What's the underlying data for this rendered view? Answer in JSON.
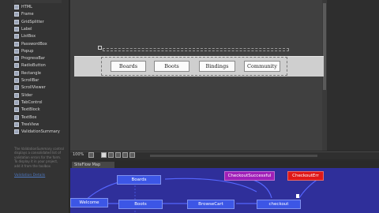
{
  "toolbox": {
    "items": [
      {
        "label": "HTML",
        "icon": "tag-icon"
      },
      {
        "label": "Frame",
        "icon": "frame-icon"
      },
      {
        "label": "GridSplitter",
        "icon": "grid-splitter-icon"
      },
      {
        "label": "Label",
        "icon": "label-icon"
      },
      {
        "label": "ListBox",
        "icon": "listbox-icon"
      },
      {
        "label": "PasswordBox",
        "icon": "password-icon"
      },
      {
        "label": "Popup",
        "icon": "popup-icon"
      },
      {
        "label": "ProgressBar",
        "icon": "progressbar-icon"
      },
      {
        "label": "RadioButton",
        "icon": "radio-icon"
      },
      {
        "label": "Rectangle",
        "icon": "rectangle-icon"
      },
      {
        "label": "ScrollBar",
        "icon": "scrollbar-icon"
      },
      {
        "label": "ScrollViewer",
        "icon": "scrollviewer-icon"
      },
      {
        "label": "Slider",
        "icon": "slider-icon"
      },
      {
        "label": "TabControl",
        "icon": "tabcontrol-icon"
      },
      {
        "label": "TextBlock",
        "icon": "textblock-icon"
      },
      {
        "label": "TextBox",
        "icon": "textbox-icon"
      },
      {
        "label": "TreeView",
        "icon": "treeview-icon"
      },
      {
        "label": "ValidationSummary",
        "icon": "validation-icon"
      }
    ],
    "description": "The ValidationSummary control displays a consolidated list of validation errors for the form. To display it in your project, add it from the toolbox",
    "link": "Validation Details"
  },
  "designer": {
    "nav_buttons": [
      "Boards",
      "Boots",
      "Bindings",
      "Community"
    ]
  },
  "statusbar": {
    "zoom": "100%"
  },
  "sitemap": {
    "tab": "SiteFlow Map",
    "nodes": {
      "welcome": "Welcome",
      "boards": "Boards",
      "boots": "Boots",
      "browse": "BrowseCart",
      "checkout": "checkout",
      "success": "CheckoutSuccessful",
      "error": "CheckoutErr"
    },
    "colors": {
      "canvas": "#2f2f9a",
      "node": "#3c56e6",
      "success": "#a01fb8",
      "error": "#e01818"
    }
  }
}
